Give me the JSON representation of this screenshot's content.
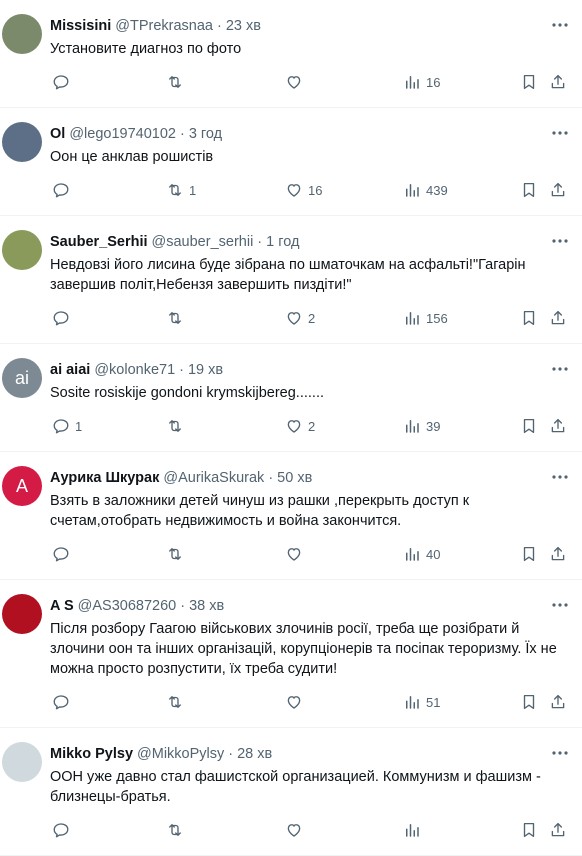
{
  "replies": [
    {
      "name": "Missisini",
      "handle": "@TPrekrasnaa",
      "sep": "·",
      "time": "23 хв",
      "text": "Установите диагноз по фото",
      "reply_count": "",
      "retweet_count": "",
      "like_count": "",
      "views": "16",
      "avatar_color": "#7a8a6a"
    },
    {
      "name": "Ol",
      "handle": "@lego19740102",
      "sep": "·",
      "time": "3 год",
      "text": "Оон це анклав рошистів",
      "reply_count": "",
      "retweet_count": "1",
      "like_count": "16",
      "views": "439",
      "avatar_color": "#5d6f86"
    },
    {
      "name": "Sauber_Serhii",
      "handle": "@sauber_serhii",
      "sep": "·",
      "time": "1 год",
      "text": "Невдовзі його лисина буде зібрана по шматочкам на асфальті!\"Гагарін завершив політ,Небензя завершить пиздіти!\"",
      "reply_count": "",
      "retweet_count": "",
      "like_count": "2",
      "views": "156",
      "avatar_color": "#8a9a5a"
    },
    {
      "name": "ai aiai",
      "handle": "@kolonke71",
      "sep": "·",
      "time": "19 хв",
      "text": "Sosite rosiskije gondoni krymskijbereg.......",
      "reply_count": "1",
      "retweet_count": "",
      "like_count": "2",
      "views": "39",
      "avatar_letter": "ai",
      "avatar_color": "#7d8a94"
    },
    {
      "name": "Аурика Шкурак",
      "handle": "@AurikaSkurak",
      "sep": "·",
      "time": "50 хв",
      "text": "Взять в заложники детей чинуш из рашки ,перекрыть доступ к счетам,отобрать недвижимость и война закончится.",
      "reply_count": "",
      "retweet_count": "",
      "like_count": "",
      "views": "40",
      "avatar_letter": "A",
      "avatar_color": "#d31b46"
    },
    {
      "name": "A S",
      "handle": "@AS30687260",
      "sep": "·",
      "time": "38 хв",
      "text": "Після розбору Гаагою військових злочинів росії, треба ще розібрати й злочини оон та інших організацій, корупціонерів та посіпак тероризму. Їх не можна просто розпустити, їх треба судити!",
      "reply_count": "",
      "retweet_count": "",
      "like_count": "",
      "views": "51",
      "avatar_color": "#b01020"
    },
    {
      "name": "Mikko Pylsy",
      "handle": "@MikkoPylsy",
      "sep": "·",
      "time": "28 хв",
      "text": "ООН уже давно стал фашистской организацией. Коммунизм и фашизм - близнецы-братья.",
      "reply_count": "",
      "retweet_count": "",
      "like_count": "",
      "views": "",
      "avatar_color": "#cfd9de"
    }
  ],
  "icons": {
    "reply": "reply-icon",
    "retweet": "retweet-icon",
    "like": "like-icon",
    "views": "views-icon",
    "bookmark": "bookmark-icon",
    "share": "share-icon",
    "more": "more-icon"
  }
}
